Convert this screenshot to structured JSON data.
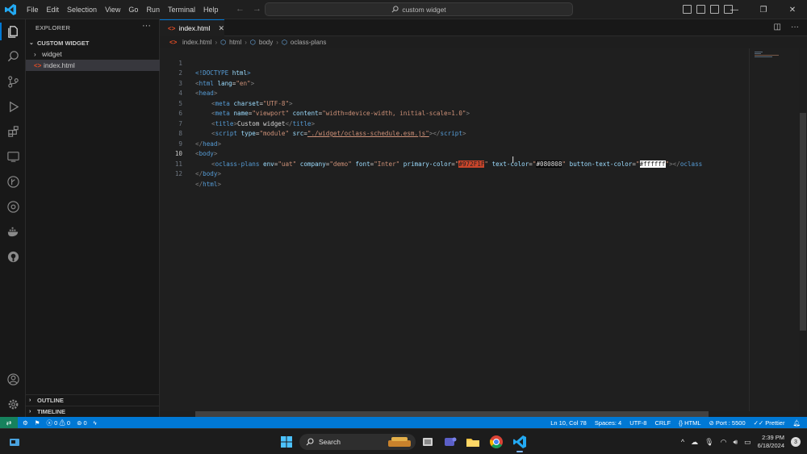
{
  "menu": [
    "File",
    "Edit",
    "Selection",
    "View",
    "Go",
    "Run",
    "Terminal",
    "Help"
  ],
  "command_center": {
    "text": "custom widget"
  },
  "explorer": {
    "title": "EXPLORER",
    "more": "···",
    "workspace": "CUSTOM WIDGET",
    "items": [
      {
        "name": "widget",
        "type": "folder"
      },
      {
        "name": "index.html",
        "type": "file"
      }
    ],
    "outline": "OUTLINE",
    "timeline": "TIMELINE"
  },
  "tab": {
    "label": "index.html",
    "close": "✕"
  },
  "breadcrumbs": [
    "index.html",
    "html",
    "body",
    "oclass-plans"
  ],
  "editor": {
    "lines": [
      "1",
      "2",
      "3",
      "4",
      "5",
      "6",
      "7",
      "8",
      "9",
      "10",
      "11",
      "12"
    ],
    "current_line": "10",
    "l1": {
      "a": "<!DOCTYPE",
      "b": " html",
      "c": ">"
    },
    "l2": {
      "open": "<",
      "tag": "html",
      "attr": " lang",
      "eq": "=",
      "val": "\"en\"",
      "close": ">"
    },
    "l3": {
      "open": "<",
      "tag": "head",
      "close": ">"
    },
    "l4": {
      "open": "<",
      "tag": "meta",
      "attr": " charset",
      "eq": "=",
      "val": "\"UTF-8\"",
      "close": ">"
    },
    "l5": {
      "open": "<",
      "tag": "meta",
      "attr1": " name",
      "eq1": "=",
      "val1": "\"viewport\"",
      "attr2": " content",
      "eq2": "=",
      "val2": "\"width=device-width, initial-scale=1.0\"",
      "close": ">"
    },
    "l6": {
      "open": "<",
      "tag": "title",
      "close": ">",
      "text": "Custom widget",
      "open2": "</",
      "tag2": "title",
      "close2": ">"
    },
    "l7": {
      "open": "<",
      "tag": "script",
      "attr1": " type",
      "eq1": "=",
      "val1": "\"module\"",
      "attr2": " src",
      "eq2": "=",
      "val2": "\"./widget/oclass-schedule.esm.js\"",
      "close": "></",
      "tag2": "script",
      "close2": ">"
    },
    "l8": {
      "open": "</",
      "tag": "head",
      "close": ">"
    },
    "l9": {
      "open": "<",
      "tag": "body",
      "close": ">"
    },
    "l10": {
      "open": "<",
      "tag": "oclass-plans",
      "a1": " env",
      "eq": "=",
      "v1": "\"uat\"",
      "a2": " company",
      "v2": "\"demo\"",
      "a3": " font",
      "v3": "\"Inter\"",
      "a4": " primary-color",
      "q": "\"",
      "v4": "#972F1F",
      "a5": " text-color",
      "v5": "#080808",
      "a6": " button-text-color",
      "v6": "#ffffff",
      "close": "></",
      "tag2": "oclass"
    },
    "l11": {
      "open": "</",
      "tag": "body",
      "close": ">"
    },
    "l12": {
      "open": "</",
      "tag": "html",
      "close": ">"
    }
  },
  "statusbar": {
    "errors": "0",
    "warnings": "0",
    "ports": "0",
    "position": "Ln 10, Col 78",
    "spaces": "Spaces: 4",
    "encoding": "UTF-8",
    "eol": "CRLF",
    "language": "HTML",
    "port": "Port : 5500",
    "formatter": "Prettier"
  },
  "taskbar": {
    "search": "Search",
    "time": "2:39 PM",
    "date": "6/18/2024",
    "notifications": "3"
  },
  "colors": {
    "accent": "#0078d4",
    "primary_swatch": "#972F1F"
  }
}
